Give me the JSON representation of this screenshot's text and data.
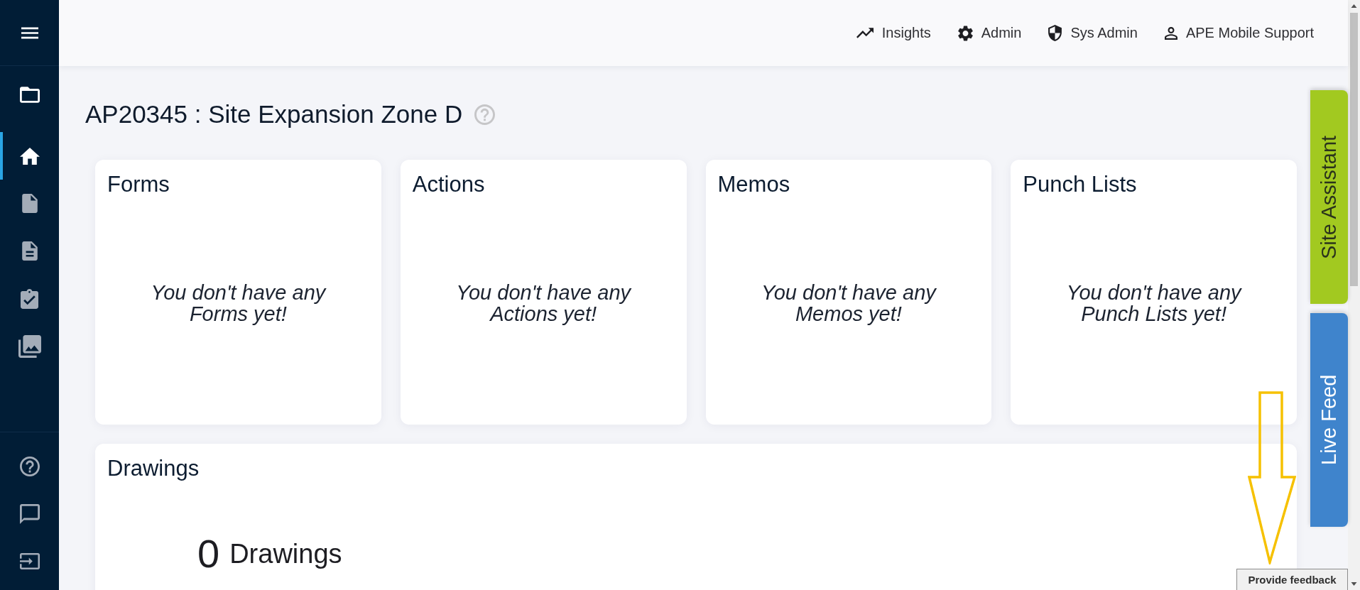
{
  "top_nav": [
    {
      "label": "Insights"
    },
    {
      "label": "Admin"
    },
    {
      "label": "Sys Admin"
    },
    {
      "label": "APE Mobile Support"
    }
  ],
  "sidebar": {
    "nav": [
      {
        "selected": true
      },
      {
        "selected": false
      },
      {
        "selected": false
      },
      {
        "selected": false
      },
      {
        "selected": false
      }
    ]
  },
  "page": {
    "title": "AP20345 : Site Expansion Zone D"
  },
  "cards": [
    {
      "title": "Forms",
      "empty_message": "You don't have any Forms yet!"
    },
    {
      "title": "Actions",
      "empty_message": "You don't have any Actions yet!"
    },
    {
      "title": "Memos",
      "empty_message": "You don't have any Memos yet!"
    },
    {
      "title": "Punch Lists",
      "empty_message": "You don't have any Punch Lists yet!"
    }
  ],
  "drawings": {
    "title": "Drawings",
    "count": "0",
    "count_label": "Drawings"
  },
  "side_tabs": [
    {
      "label": "Site Assistant",
      "color": "#a2c920"
    },
    {
      "label": "Live Feed",
      "color": "#3f84cc"
    }
  ],
  "feedback": {
    "label": "Provide feedback"
  }
}
